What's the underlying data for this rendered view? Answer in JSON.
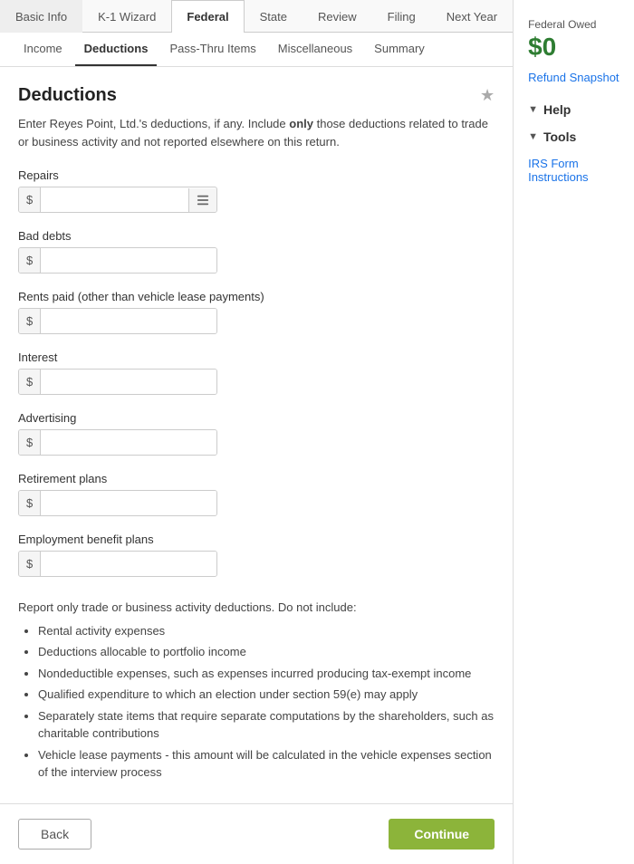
{
  "topTabs": {
    "items": [
      {
        "label": "Basic Info",
        "id": "basic-info",
        "active": false
      },
      {
        "label": "K-1 Wizard",
        "id": "k1-wizard",
        "active": false
      },
      {
        "label": "Federal",
        "id": "federal",
        "active": true
      },
      {
        "label": "State",
        "id": "state",
        "active": false
      },
      {
        "label": "Review",
        "id": "review",
        "active": false
      },
      {
        "label": "Filing",
        "id": "filing",
        "active": false
      },
      {
        "label": "Next Year",
        "id": "next-year",
        "active": false
      }
    ]
  },
  "subTabs": {
    "items": [
      {
        "label": "Income",
        "id": "income",
        "active": false
      },
      {
        "label": "Deductions",
        "id": "deductions",
        "active": true
      },
      {
        "label": "Pass-Thru Items",
        "id": "pass-thru",
        "active": false
      },
      {
        "label": "Miscellaneous",
        "id": "misc",
        "active": false
      },
      {
        "label": "Summary",
        "id": "summary",
        "active": false
      }
    ]
  },
  "page": {
    "title": "Deductions",
    "description1": "Enter Reyes Point, Ltd.'s deductions, if any. Include ",
    "description_bold": "only",
    "description2": " those deductions related to trade or business activity and not reported elsewhere on this return."
  },
  "fields": [
    {
      "id": "repairs",
      "label": "Repairs",
      "value": "",
      "hasListIcon": true
    },
    {
      "id": "bad-debts",
      "label": "Bad debts",
      "value": "",
      "hasListIcon": false
    },
    {
      "id": "rents-paid",
      "label": "Rents paid (other than vehicle lease payments)",
      "value": "",
      "hasListIcon": false
    },
    {
      "id": "interest",
      "label": "Interest",
      "value": "",
      "hasListIcon": false
    },
    {
      "id": "advertising",
      "label": "Advertising",
      "value": "",
      "hasListIcon": false
    },
    {
      "id": "retirement-plans",
      "label": "Retirement plans",
      "value": "",
      "hasListIcon": false
    },
    {
      "id": "employment-benefit-plans",
      "label": "Employment benefit plans",
      "value": "",
      "hasListIcon": false
    }
  ],
  "notes": {
    "intro": "Report only trade or business activity deductions. Do not include:",
    "items": [
      "Rental activity expenses",
      "Deductions allocable to portfolio income",
      "Nondeductible expenses, such as expenses incurred producing tax-exempt income",
      "Qualified expenditure to which an election under section 59(e) may apply",
      "Separately state items that require separate computations by the shareholders, such as charitable contributions",
      "Vehicle lease payments - this amount will be calculated in the vehicle expenses section of the interview process"
    ]
  },
  "footer": {
    "back_label": "Back",
    "continue_label": "Continue"
  },
  "sidebar": {
    "federal_owed_label": "Federal Owed",
    "federal_owed_amount": "$0",
    "refund_snapshot_label": "Refund Snapshot",
    "help_label": "Help",
    "tools_label": "Tools",
    "irs_form_label": "IRS Form Instructions"
  }
}
